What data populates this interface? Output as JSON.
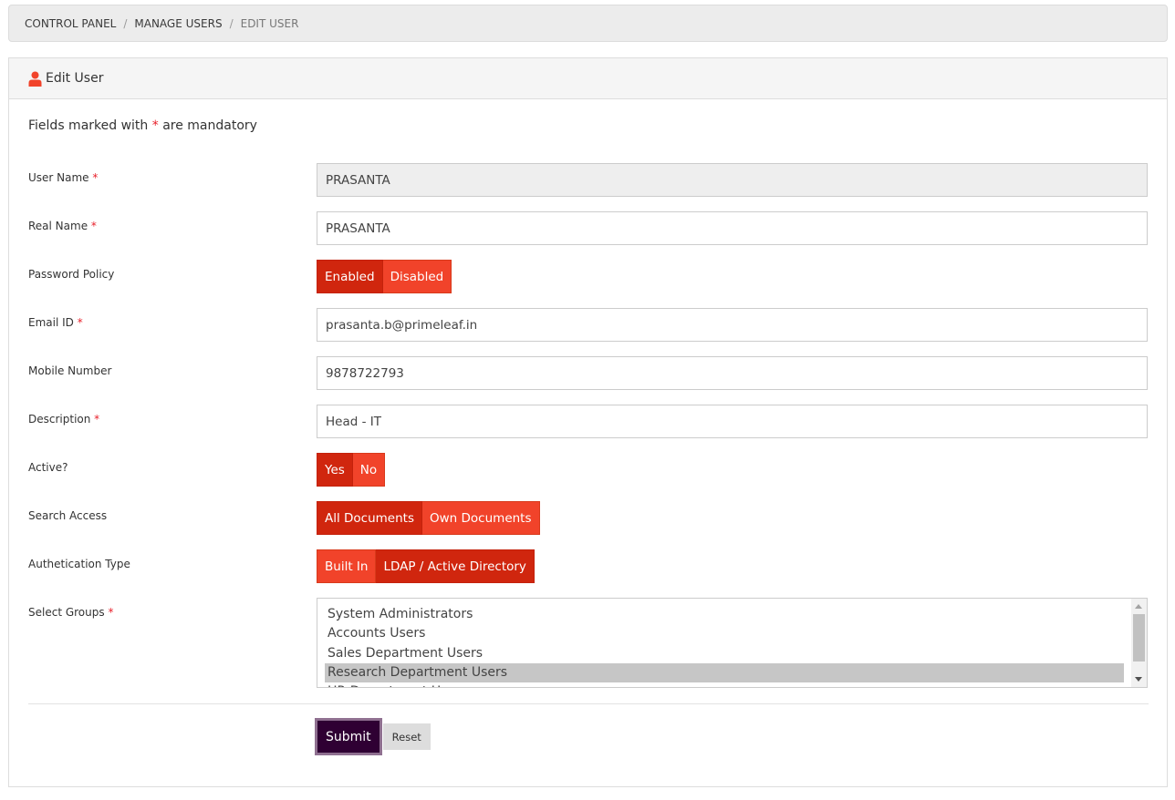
{
  "breadcrumb": {
    "items": [
      "Control Panel",
      "Manage Users",
      "Edit User"
    ],
    "separator": "/"
  },
  "panel": {
    "title": "Edit User",
    "icon": "user-icon"
  },
  "form": {
    "mandatory_note": {
      "prefix": "Fields marked with",
      "marker": "*",
      "suffix": "are mandatory"
    },
    "required_marker": "*",
    "fields": {
      "user_name": {
        "label": "User Name",
        "required": true,
        "value": "PRASANTA",
        "readonly": true
      },
      "real_name": {
        "label": "Real Name",
        "required": true,
        "value": "PRASANTA"
      },
      "password_policy": {
        "label": "Password Policy",
        "options": [
          "Enabled",
          "Disabled"
        ],
        "selected": "Enabled"
      },
      "email": {
        "label": "Email ID",
        "required": true,
        "value": "prasanta.b@primeleaf.in"
      },
      "mobile": {
        "label": "Mobile Number",
        "value": "9878722793"
      },
      "description": {
        "label": "Description",
        "required": true,
        "value": "Head - IT"
      },
      "active": {
        "label": "Active?",
        "options": [
          "Yes",
          "No"
        ],
        "selected": "Yes"
      },
      "search_access": {
        "label": "Search Access",
        "options": [
          "All Documents",
          "Own Documents"
        ],
        "selected": "All Documents"
      },
      "auth_type": {
        "label": "Authetication Type",
        "options": [
          "Built In",
          "LDAP / Active Directory"
        ],
        "selected": "LDAP / Active Directory"
      },
      "groups": {
        "label": "Select Groups",
        "required": true,
        "options": [
          "System Administrators",
          "Accounts Users",
          "Sales Department Users",
          "Research Department Users",
          "HR Department Users"
        ],
        "selected": [
          "Research Department Users"
        ]
      }
    },
    "actions": {
      "submit_label": "Submit",
      "reset_label": "Reset"
    }
  },
  "colors": {
    "toggle_active": "#d0260e",
    "toggle_inactive": "#f1432a",
    "submit_bg": "#2f0033",
    "required": "#e8202a"
  }
}
